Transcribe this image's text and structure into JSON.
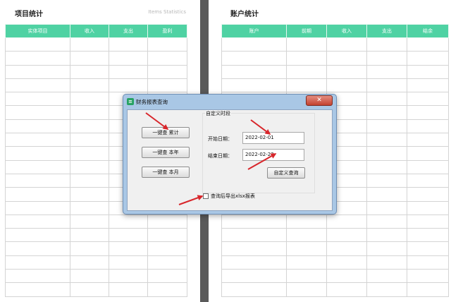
{
  "left_sheet": {
    "title": "项目统计",
    "subtitle": "Items Statistics",
    "columns": [
      "实体项目",
      "收入",
      "支出",
      "盈利"
    ]
  },
  "right_sheet": {
    "title": "账户统计",
    "columns": [
      "账户",
      "前期",
      "收入",
      "支出",
      "结余"
    ]
  },
  "dialog": {
    "title": "财务报表查询",
    "icon": "spreadsheet-app-icon",
    "close_label": "✕",
    "buttons": {
      "cumulative": "一键查  累计",
      "this_year": "一键查  本年",
      "this_month": "一键查  本月",
      "custom_query": "自定义查询"
    },
    "custom_period": {
      "label": "自定义时段",
      "start_label": "开始日期：",
      "start_value": "2022-02-01",
      "end_label": "结束日期：",
      "end_value": "2022-02-22"
    },
    "export_checkbox": {
      "label": "查询后导出xlsx报表",
      "checked": false
    }
  },
  "colors": {
    "header_green": "#4fd2a3",
    "divider_gray": "#5a5a5a",
    "arrow_red": "#d8262b"
  }
}
